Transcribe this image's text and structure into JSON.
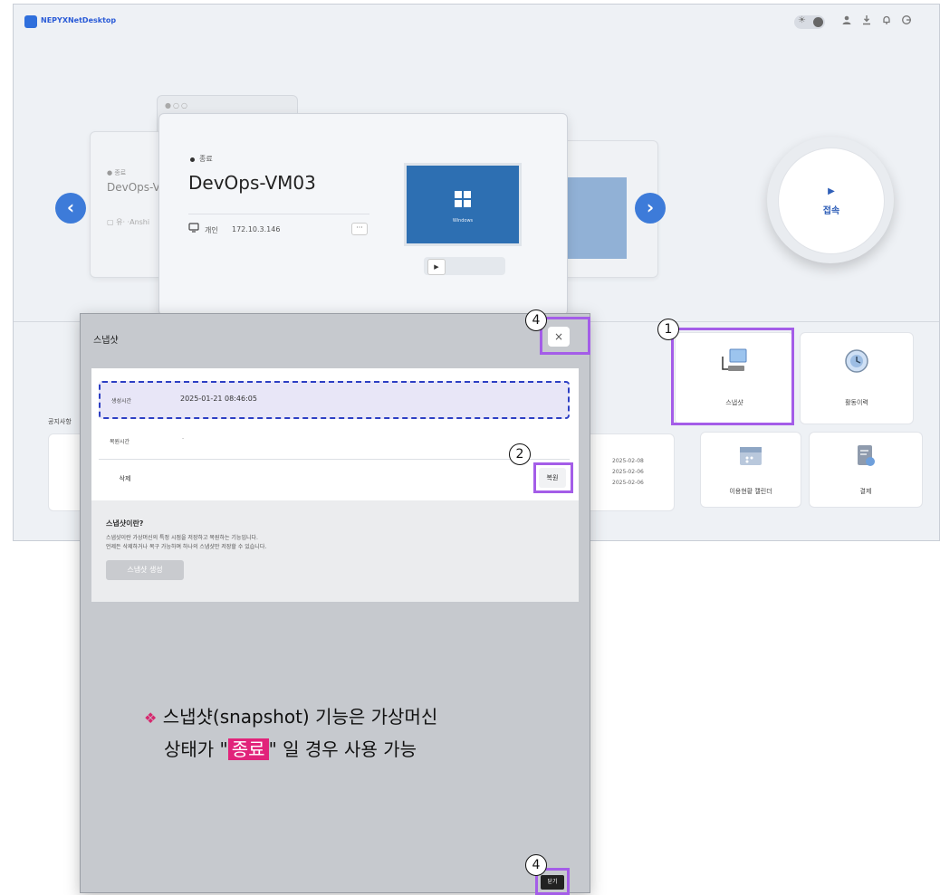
{
  "app": {
    "logo_text": "NEPYXNetDesktop",
    "theme_sun": "☀",
    "top_icons": [
      "user-icon",
      "download-icon",
      "bell-icon",
      "logout-icon"
    ]
  },
  "carousel": {
    "left_card": {
      "status": "● 종료",
      "name": "DevOps-V",
      "meta": "▢ 유· ·Anshi"
    },
    "main_card": {
      "status": "종료",
      "name": "DevOps-VM03",
      "owner": "개인",
      "ip": "172.10.3.146",
      "more": "···",
      "thumb_label": "Windows"
    },
    "prev_glyph": "‹",
    "next_glyph": "›"
  },
  "connect": {
    "play": "▶",
    "label": "접속"
  },
  "tiles": {
    "snapshot": "스냅샷",
    "history": "활동이력",
    "calendar": "이용현황 캘린더",
    "payment": "결제"
  },
  "notice": {
    "label": "공지사항",
    "dates": [
      "2025-02-08",
      "2025-02-06",
      "2025-02-06"
    ]
  },
  "modal": {
    "title": "스냅샷",
    "close": "×",
    "created_key": "생성시간",
    "created_value": "2025-01-21 08:46:05",
    "restore_key": "복원시간",
    "restore_value": "-",
    "delete_label": "삭제",
    "restore_label": "복원",
    "info_title": "스냅샷이란?",
    "info_line1": "스냅샷이란 가상머신의 특정 시점을 저장하고 복원하는 기능입니다.",
    "info_line2": "언제든 삭제하거나 복구 가능하며 하나의 스냅샷만 저장할 수 있습니다.",
    "create_label": "스냅샷 생성",
    "close_bottom": "닫기"
  },
  "annotation": {
    "diamond": "❖",
    "line1": "스냅샷(snapshot) 기능은 가상머신",
    "line2_pre": "상태가 \"",
    "highlight": "종료",
    "line2_post": "\" 일 경우 사용 가능"
  },
  "callouts": {
    "one": "1",
    "two": "2",
    "four": "4"
  },
  "colors": {
    "accent": "#3d7bd9",
    "highlight_box": "#a45de8",
    "dashed": "#2d3fc4",
    "annotation_hl": "#e1237a"
  }
}
